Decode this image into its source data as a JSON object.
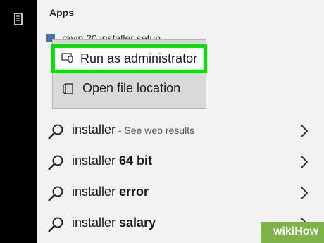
{
  "apps_section": {
    "header": "Apps",
    "partial_app_name": "ravin 20 installer setup"
  },
  "context_menu": {
    "items": [
      {
        "label": "Run as administrator",
        "icon": "shield-icon",
        "highlighted": true
      },
      {
        "label": "Open file location",
        "icon": "folder-icon",
        "highlighted": false
      }
    ]
  },
  "results": [
    {
      "query": "installer",
      "suffix": " - See web results",
      "bold": ""
    },
    {
      "query": "installer ",
      "suffix": "",
      "bold": "64 bit"
    },
    {
      "query": "installer ",
      "suffix": "",
      "bold": "error"
    },
    {
      "query": "installer ",
      "suffix": "",
      "bold": "salary"
    }
  ],
  "watermark": {
    "text": "wikiHow"
  },
  "colors": {
    "highlight_border": "#00e600",
    "menu_bg": "#d9d9d9",
    "panel_bg": "#f2f2f2"
  }
}
